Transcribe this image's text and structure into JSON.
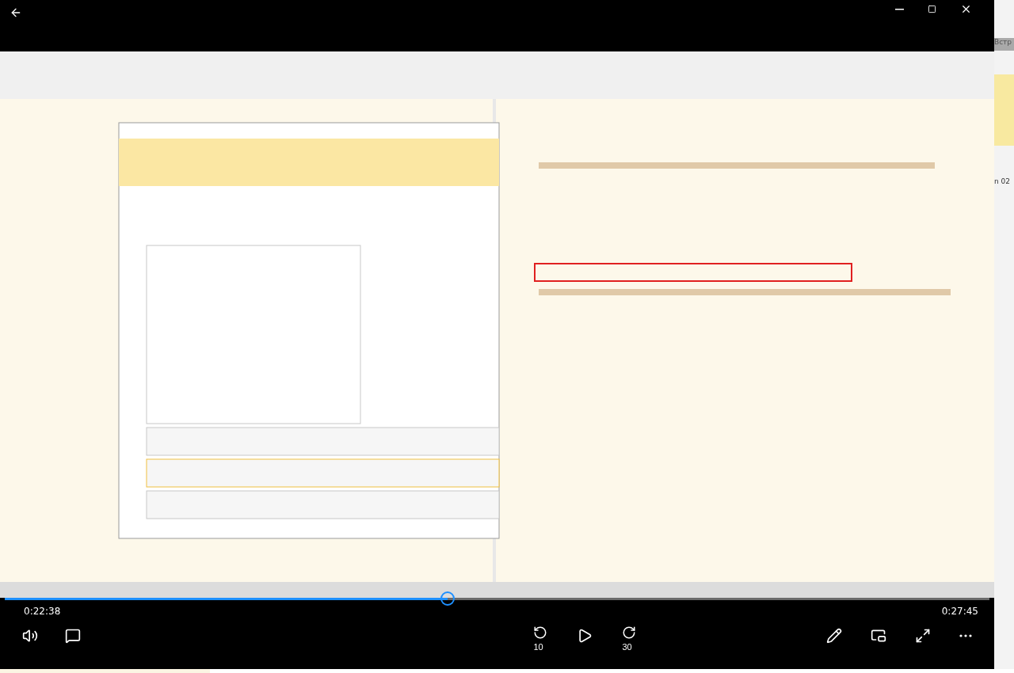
{
  "player": {
    "elapsed": "0:22:38",
    "total": "0:27:45",
    "progress": {
      "level": 0.45
    },
    "skip_back": "10",
    "skip_forward": "30"
  },
  "background_window": {
    "title": "Встр",
    "text": "n 02"
  }
}
